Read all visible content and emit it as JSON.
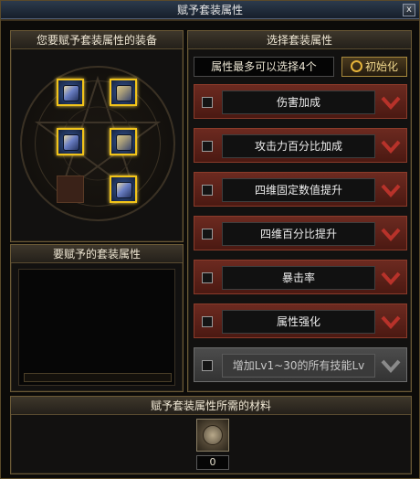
{
  "window": {
    "title": "赋予套装属性",
    "close_glyph": "x"
  },
  "equipment_panel": {
    "title": "您要赋予套装属性的装备"
  },
  "attr_panel": {
    "title": "要赋予的套装属性"
  },
  "select_panel": {
    "title": "选择套装属性",
    "limit_text": "属性最多可以选择4个",
    "init_button": "初始化",
    "attributes": [
      {
        "label": "伤害加成",
        "enabled": true
      },
      {
        "label": "攻击力百分比加成",
        "enabled": true
      },
      {
        "label": "四维固定数值提升",
        "enabled": true
      },
      {
        "label": "四维百分比提升",
        "enabled": true
      },
      {
        "label": "暴击率",
        "enabled": true
      },
      {
        "label": "属性强化",
        "enabled": true
      },
      {
        "label": "增加Lv1~30的所有技能Lv",
        "enabled": false
      }
    ]
  },
  "materials_panel": {
    "title": "赋予套装属性所需的材料",
    "count": "0"
  },
  "colors": {
    "slot_border": "#f2c419",
    "row_red": "#6c2a20",
    "row_gray": "#4c4c4c",
    "arrow_red": "#b8322a"
  }
}
